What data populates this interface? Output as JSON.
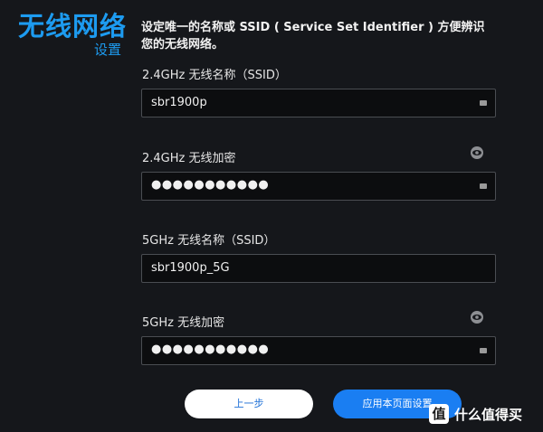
{
  "header": {
    "title": "无线网络",
    "subtitle": "设置",
    "description": "设定唯一的名称或 SSID ( Service Set Identifier ) 方便辨识您的无线网络。"
  },
  "fields": [
    {
      "label": "2.4GHz 无线名称（SSID）",
      "value": "sbr1900p",
      "type": "text"
    },
    {
      "label": "2.4GHz 无线加密",
      "value": "●●●●●●●●●●●",
      "type": "password"
    },
    {
      "label": "5GHz 无线名称（SSID）",
      "value": "sbr1900p_5G",
      "type": "text"
    },
    {
      "label": "5GHz 无线加密",
      "value": "●●●●●●●●●●●",
      "type": "password"
    }
  ],
  "buttons": {
    "back": "上一步",
    "apply": "应用本页面设置"
  },
  "watermark": {
    "logo": "值",
    "text": "什么值得买"
  },
  "colors": {
    "accent": "#1d9bf0",
    "background": "#15171b",
    "primary_button": "#1a7ef2"
  }
}
